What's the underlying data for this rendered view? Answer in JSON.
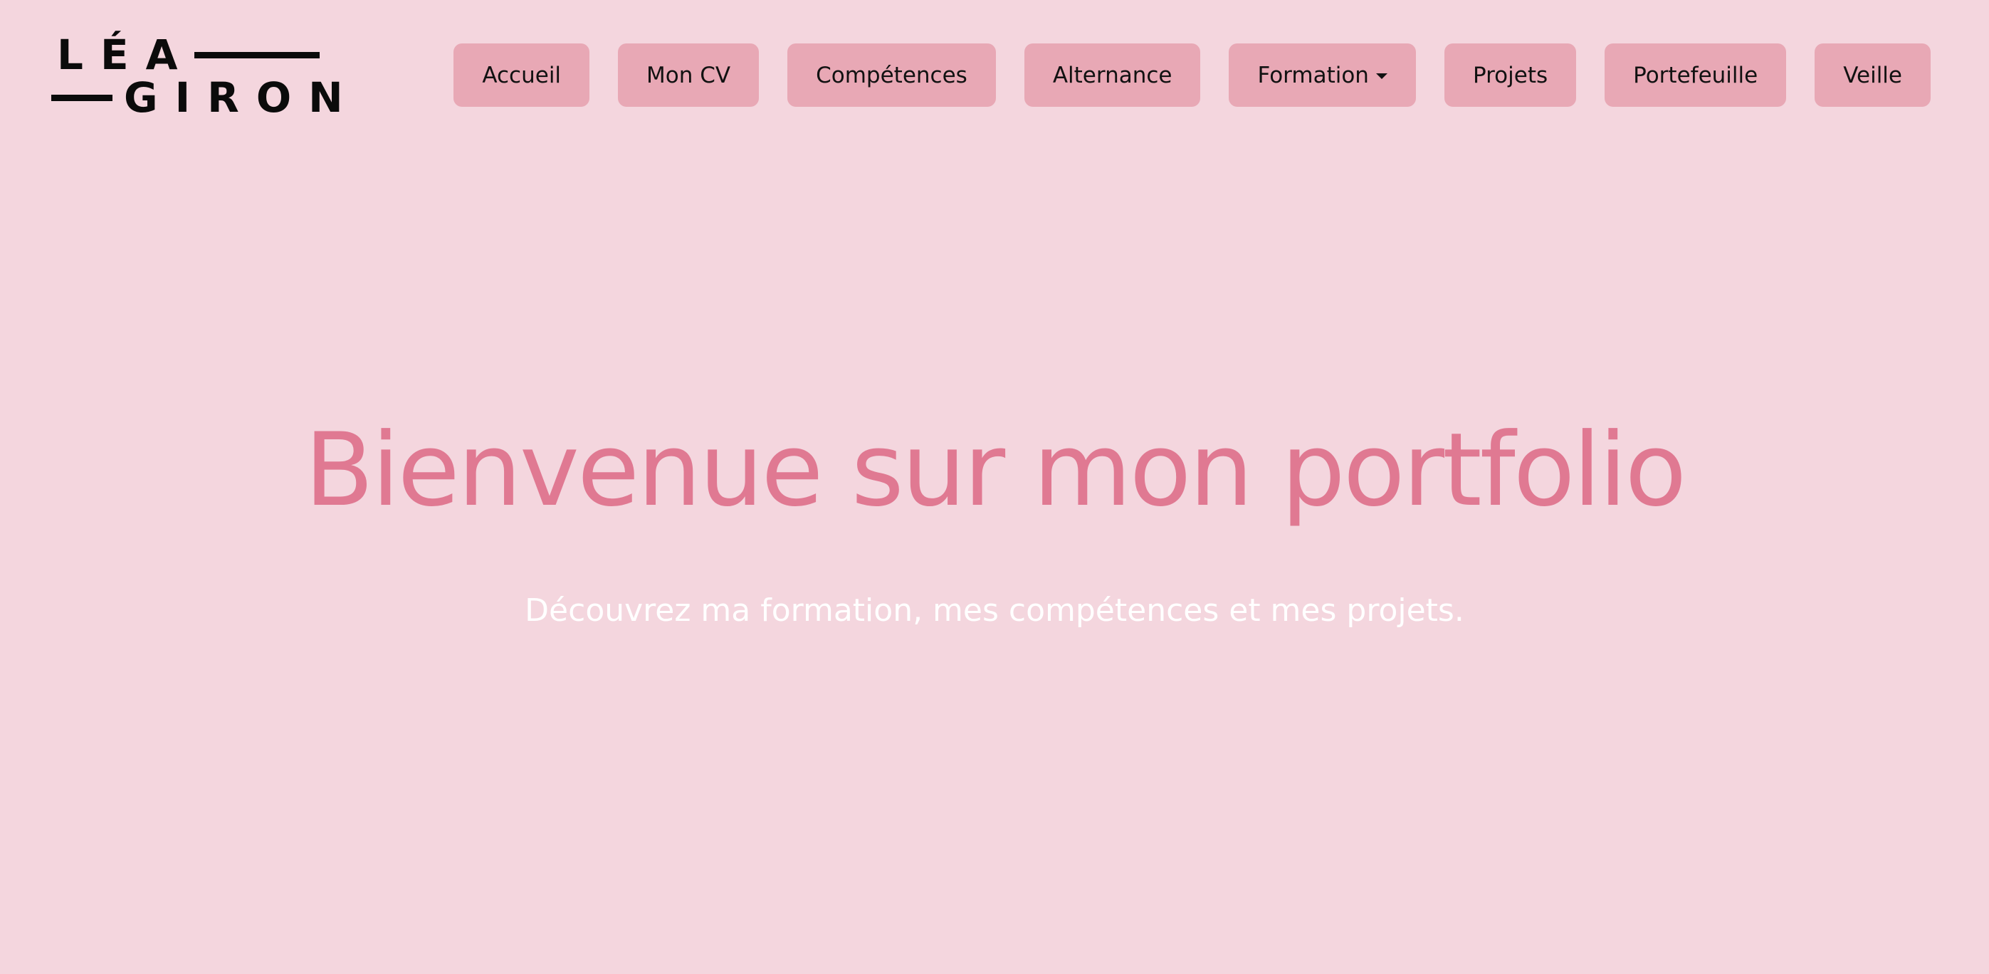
{
  "logo": {
    "line1": "LÉA",
    "line2": "GIRON"
  },
  "nav": {
    "items": [
      {
        "label": "Accueil"
      },
      {
        "label": "Mon CV"
      },
      {
        "label": "Compétences"
      },
      {
        "label": "Alternance"
      },
      {
        "label": "Formation",
        "has_dropdown": true
      },
      {
        "label": "Projets"
      },
      {
        "label": "Portefeuille"
      },
      {
        "label": "Veille"
      }
    ]
  },
  "hero": {
    "title": "Bienvenue sur mon portfolio",
    "subtitle": "Découvrez ma formation, mes compétences et mes projets."
  },
  "colors": {
    "background": "#f4d6de",
    "nav_button": "#e8a8b5",
    "title": "#e07992",
    "subtitle": "#ffffff",
    "logo": "#0b0b0b"
  },
  "icons": {
    "dropdown": "caret-down-icon"
  }
}
